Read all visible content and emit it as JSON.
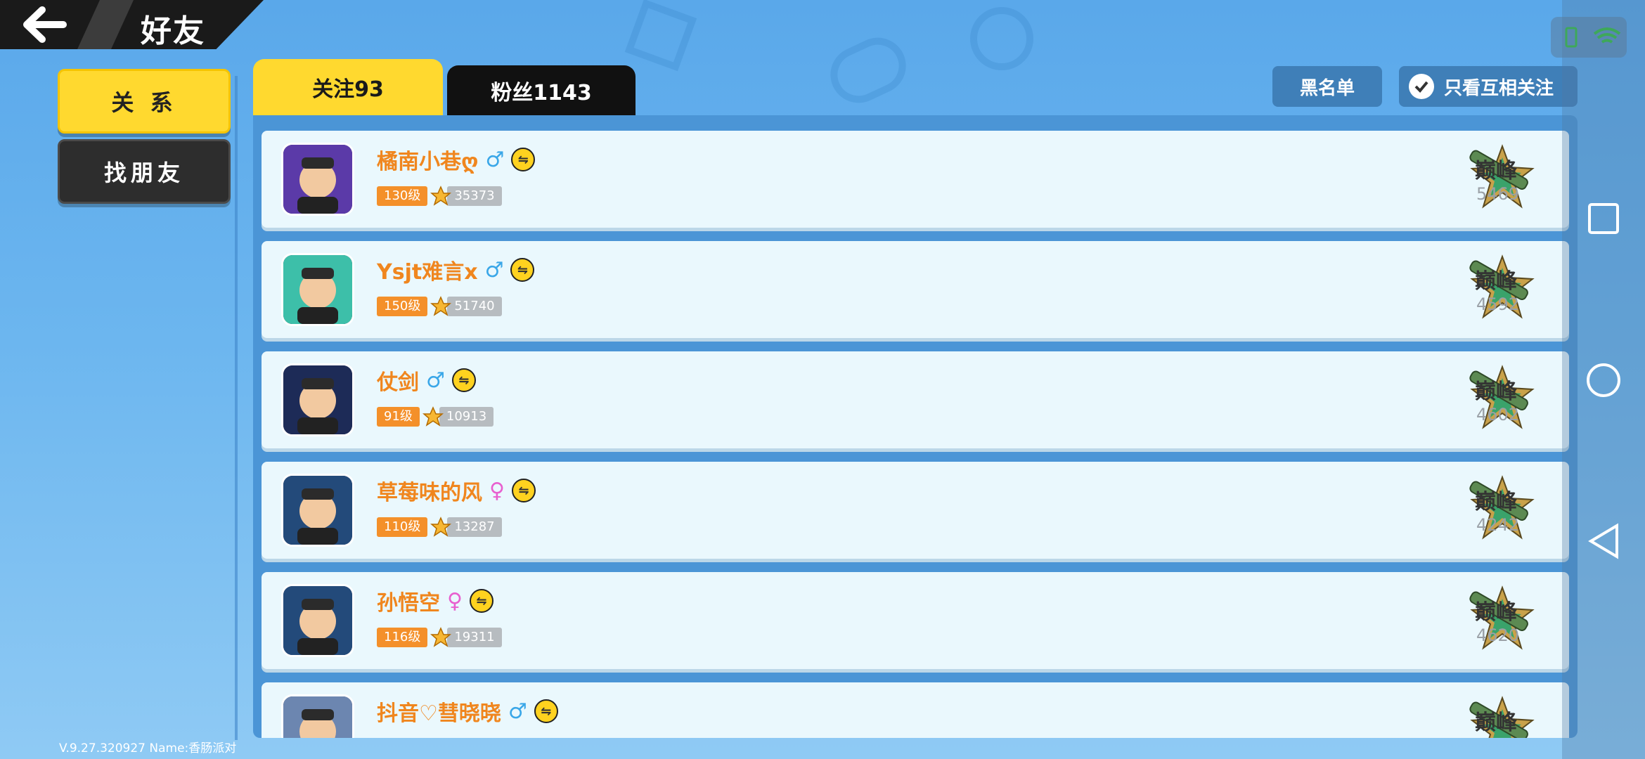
{
  "header": {
    "title": "好友"
  },
  "nav": {
    "relations_label": "关 系",
    "find_friends_label": "找朋友"
  },
  "tabs": {
    "following_label": "关注93",
    "fans_label": "粉丝1143"
  },
  "actions": {
    "blacklist_label": "黑名单",
    "mutual_only_label": "只看互相关注"
  },
  "footer": {
    "version": "V.9.27.320927 Name:香肠派对"
  },
  "friends": [
    {
      "name": "橘南小巷ღ",
      "gender": "male",
      "level": "130级",
      "score": "35373",
      "rank": "巅峰",
      "points": "5469",
      "avatar_color": "#5b3aa8"
    },
    {
      "name": "Ysjt难言x",
      "gender": "male",
      "level": "150级",
      "score": "51740",
      "rank": "巅峰",
      "points": "4592",
      "avatar_color": "#3dbfa9"
    },
    {
      "name": "仗剑",
      "gender": "male",
      "level": "91级",
      "score": "10913",
      "rank": "巅峰",
      "points": "4602",
      "avatar_color": "#1d2b57"
    },
    {
      "name": "草莓味的风",
      "gender": "female",
      "level": "110级",
      "score": "13287",
      "rank": "巅峰",
      "points": "4242",
      "avatar_color": "#234a7a"
    },
    {
      "name": "孙悟空",
      "gender": "female",
      "level": "116级",
      "score": "19311",
      "rank": "巅峰",
      "points": "4620",
      "avatar_color": "#234a7a"
    },
    {
      "name": "抖音♡彗晓晓",
      "gender": "male",
      "level": "",
      "score": "",
      "rank": "巅峰",
      "points": "",
      "avatar_color": "#6c86b0"
    }
  ],
  "symbols": {
    "male": "♂",
    "female": "♀",
    "mutual": "⇋"
  },
  "colors": {
    "accent_yellow": "#ffd92f",
    "name_orange": "#f0861e",
    "level_orange": "#f4902a"
  }
}
